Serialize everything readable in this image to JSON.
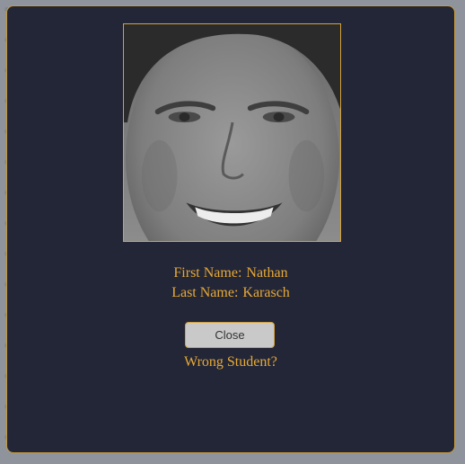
{
  "student": {
    "first_name_label": "First Name:",
    "first_name": "Nathan",
    "last_name_label": "Last Name:",
    "last_name": "Karasch",
    "photo_alt": "Student photo"
  },
  "actions": {
    "close_label": "Close",
    "wrong_student_label": "Wrong Student?"
  },
  "colors": {
    "panel_background": "#232637",
    "accent": "#e8a935",
    "border": "#d4a33d",
    "button_background": "#c9c9c9"
  }
}
